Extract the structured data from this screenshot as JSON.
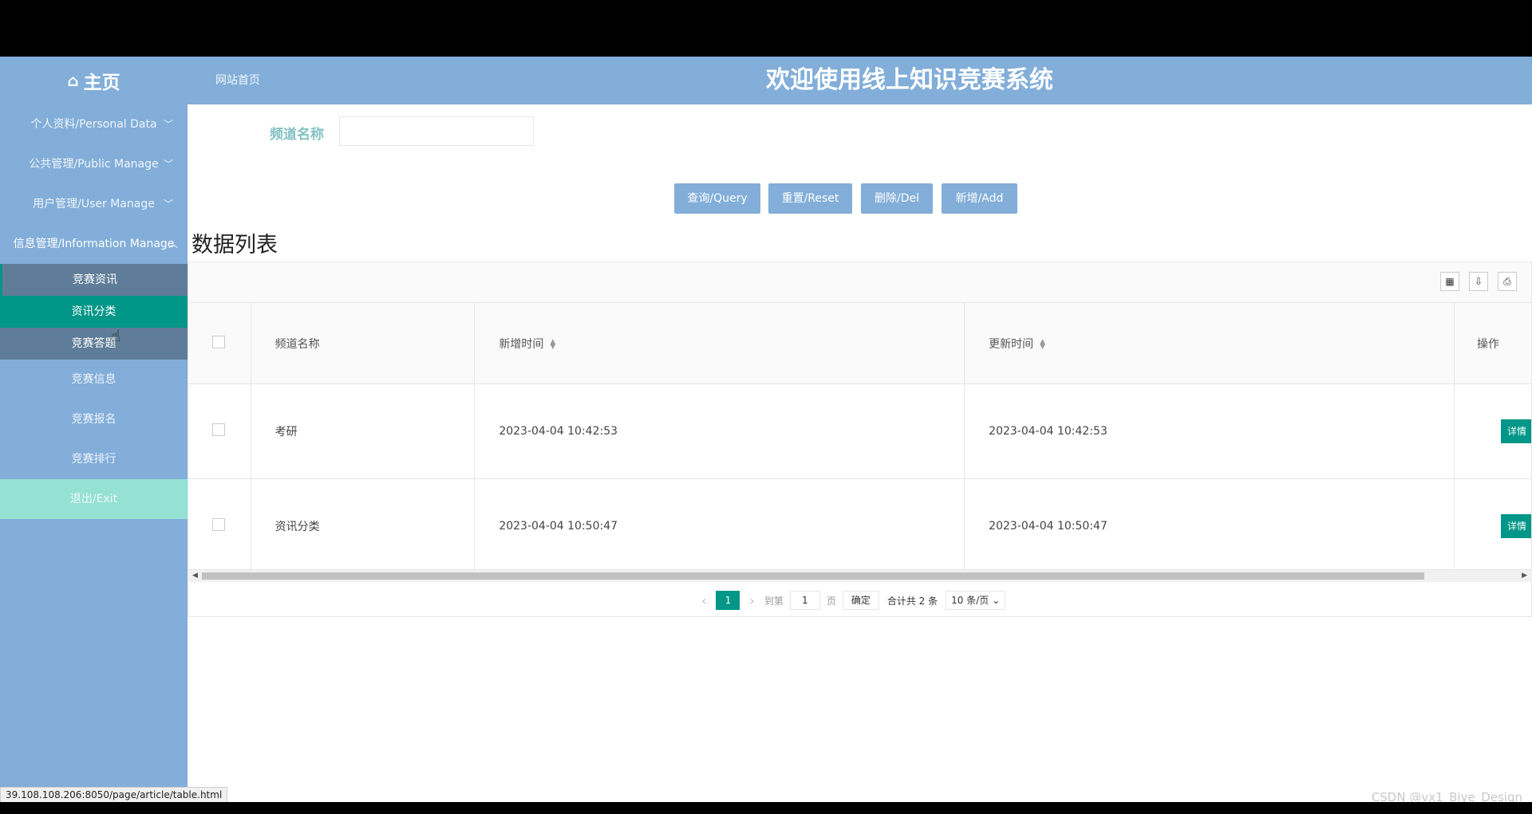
{
  "header": {
    "brand_icon": "home-icon",
    "brand": "主页",
    "home_link": "网站首页",
    "title": "欢迎使用线上知识竞赛系统"
  },
  "sidebar": {
    "menus": [
      {
        "label": "个人资料/Personal Data",
        "chevron": "chevron-down-icon"
      },
      {
        "label": "公共管理/Public Manage",
        "chevron": "chevron-down-icon"
      },
      {
        "label": "用户管理/User Manage",
        "chevron": "chevron-down-icon"
      },
      {
        "label": "信息管理/Information Manage",
        "chevron": "chevron-up-icon"
      }
    ],
    "sub_items": [
      "竞赛资讯",
      "资讯分类",
      "竞赛答题"
    ],
    "items": [
      "竞赛信息",
      "竞赛报名",
      "竞赛排行"
    ],
    "exit": "退出/Exit"
  },
  "search": {
    "label": "频道名称",
    "value": ""
  },
  "buttons": {
    "query": "查询/Query",
    "reset": "重置/Reset",
    "delete": "删除/Del",
    "add": "新增/Add"
  },
  "list_title": "数据列表",
  "table": {
    "tool_icons": [
      "columns-icon",
      "export-icon",
      "print-icon"
    ],
    "columns": [
      "频道名称",
      "新增时间",
      "更新时间",
      "操作"
    ],
    "rows": [
      {
        "name": "考研",
        "created": "2023-04-04 10:42:53",
        "updated": "2023-04-04 10:42:53",
        "action": "详情"
      },
      {
        "name": "资讯分类",
        "created": "2023-04-04 10:50:47",
        "updated": "2023-04-04 10:50:47",
        "action": "详情"
      }
    ]
  },
  "pager": {
    "current": "1",
    "goto_prefix": "到第",
    "goto_value": "1",
    "goto_suffix": "页",
    "confirm": "确定",
    "total": "合计共 2 条",
    "page_size": "10 条/页"
  },
  "statusbar": "39.108.108.206:8050/page/article/table.html",
  "watermark": "CSDN @vx1_Biye_Design"
}
